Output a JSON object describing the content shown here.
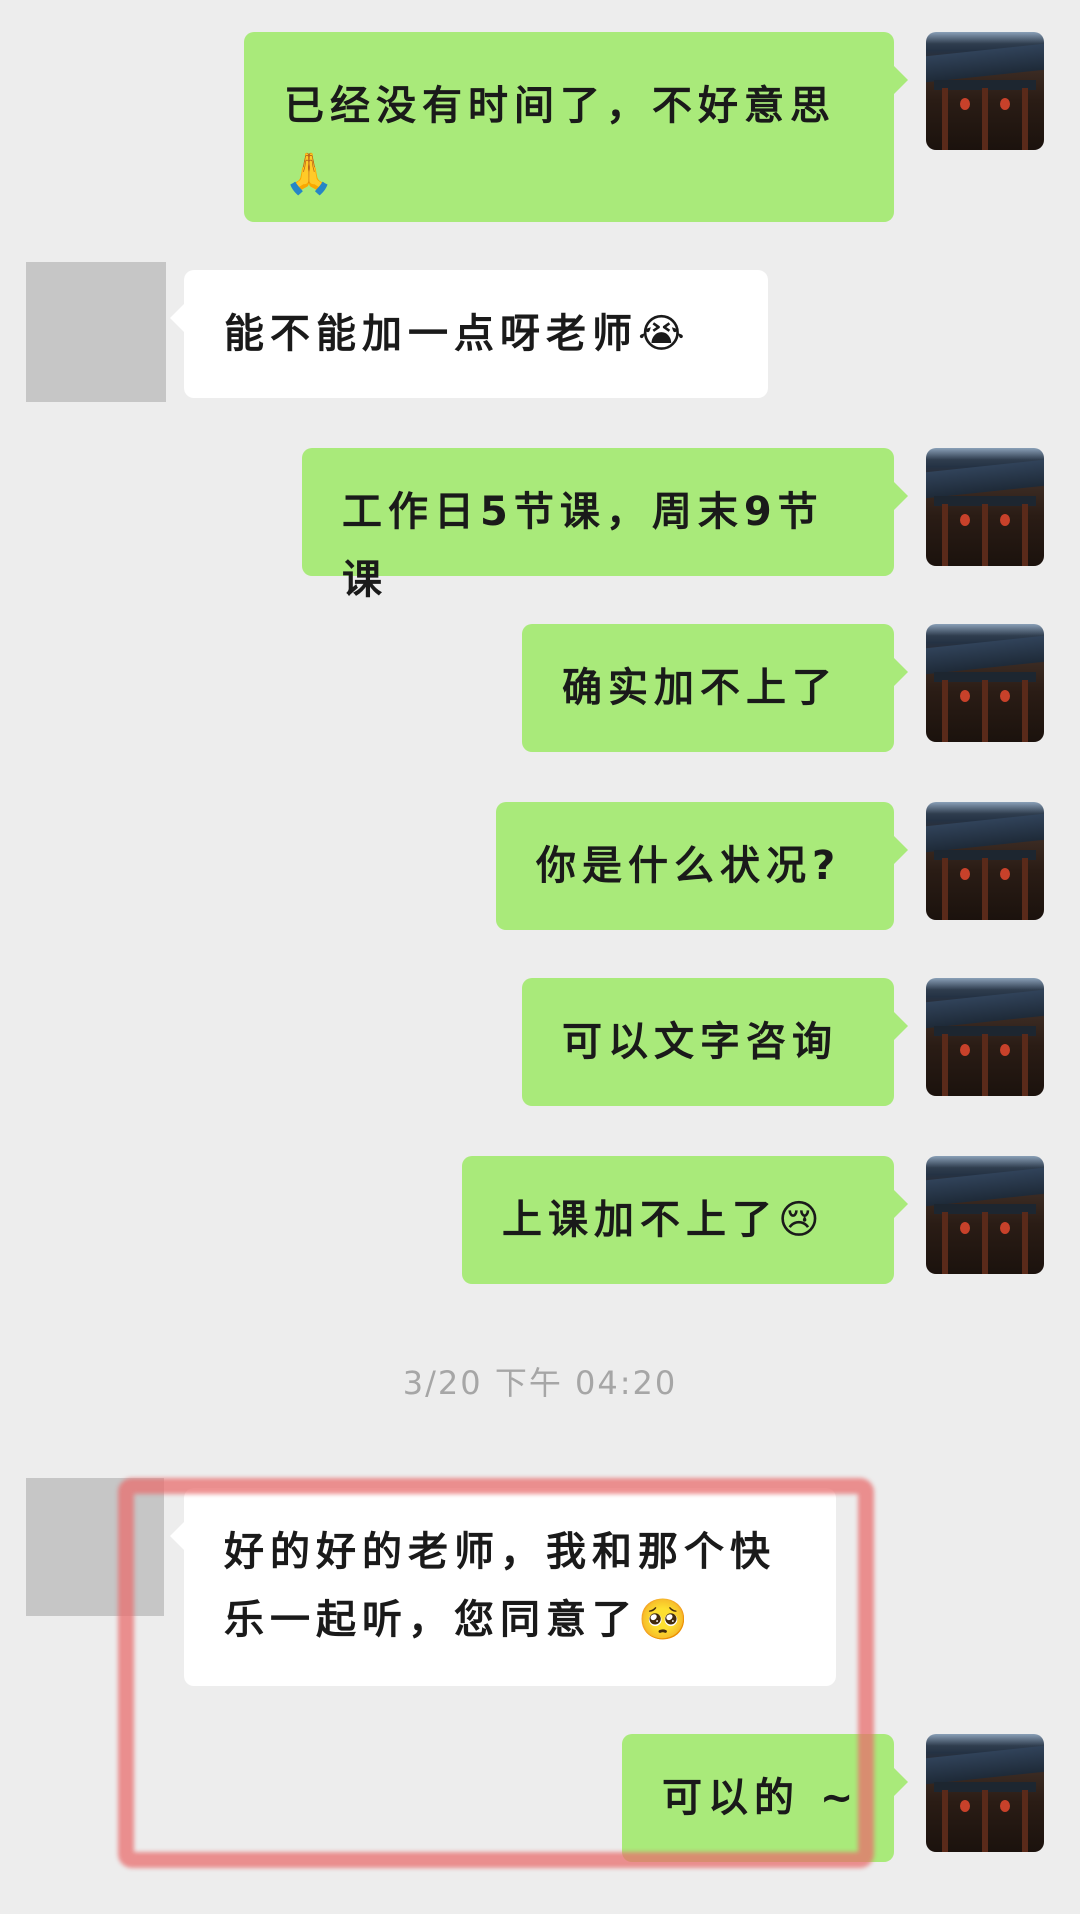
{
  "messages": [
    {
      "side": "right",
      "text": "已经没有时间了，不好意思",
      "text2": "🙏"
    },
    {
      "side": "left",
      "text": "能不能加一点呀老师😭"
    },
    {
      "side": "right",
      "text": "工作日5节课，周末9节课"
    },
    {
      "side": "right",
      "text": "确实加不上了"
    },
    {
      "side": "right",
      "text": "你是什么状况?"
    },
    {
      "side": "right",
      "text": "可以文字咨询"
    },
    {
      "side": "right",
      "text": "上课加不上了😢"
    },
    {
      "side": "left",
      "text": "好的好的老师，我和那个快",
      "text2": "乐一起听，您同意了🥺"
    },
    {
      "side": "right",
      "text": "可以的 ~"
    }
  ],
  "timestamp": "3/20 下午 04:20",
  "colors": {
    "background": "#ededed",
    "self_bubble": "#a9ea7a",
    "other_bubble": "#ffffff",
    "highlight": "#e86e6e"
  },
  "icons": {
    "self_avatar": "temple-photo-avatar",
    "other_avatar": "gray-placeholder-avatar"
  }
}
